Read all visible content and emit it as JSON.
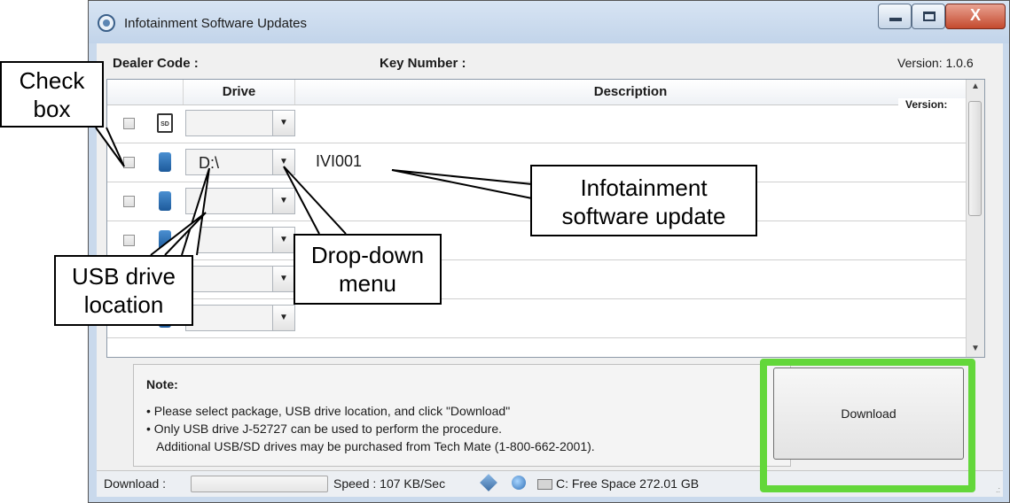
{
  "window": {
    "title": "Infotainment Software Updates",
    "close_glyph": "X"
  },
  "info": {
    "dealer_code_label": "Dealer Code :",
    "key_number_label": "Key Number :",
    "version_label": "Version: 1.0.6"
  },
  "grid": {
    "headers": {
      "drive": "Drive",
      "description": "Description"
    },
    "version_field": "Version:",
    "rows": [
      {
        "icon": "sd-card-icon",
        "drive": "",
        "description": "",
        "sd_label": "SD"
      },
      {
        "icon": "usb-drive-icon",
        "drive": "D:\\",
        "description": "IVI001"
      },
      {
        "icon": "usb-drive-icon",
        "drive": "",
        "description": ""
      },
      {
        "icon": "usb-drive-icon",
        "drive": "",
        "description": ""
      },
      {
        "icon": "usb-drive-icon",
        "drive": "",
        "description": ""
      },
      {
        "icon": "usb-drive-icon",
        "drive": "",
        "description": ""
      }
    ]
  },
  "note": {
    "title": "Note:",
    "lines": [
      "• Please select package, USB drive location, and click \"Download\"",
      "• Only USB drive J-52727 can be used to perform the procedure.",
      "Additional USB/SD drives may be purchased from Tech Mate (1-800-662-2001)."
    ]
  },
  "download_button": {
    "label": "Download",
    "highlight_color": "#63d73a"
  },
  "status": {
    "download_label": "Download :",
    "speed": "Speed : 107 KB/Sec",
    "free_space": "C: Free Space 272.01 GB",
    "grip": ".:"
  },
  "callouts": {
    "check_box": [
      "Check",
      "box"
    ],
    "usb_location": [
      "USB drive",
      "location"
    ],
    "drop_down": [
      "Drop-down",
      "menu"
    ],
    "software_update": [
      "Infotainment",
      "software update"
    ]
  }
}
